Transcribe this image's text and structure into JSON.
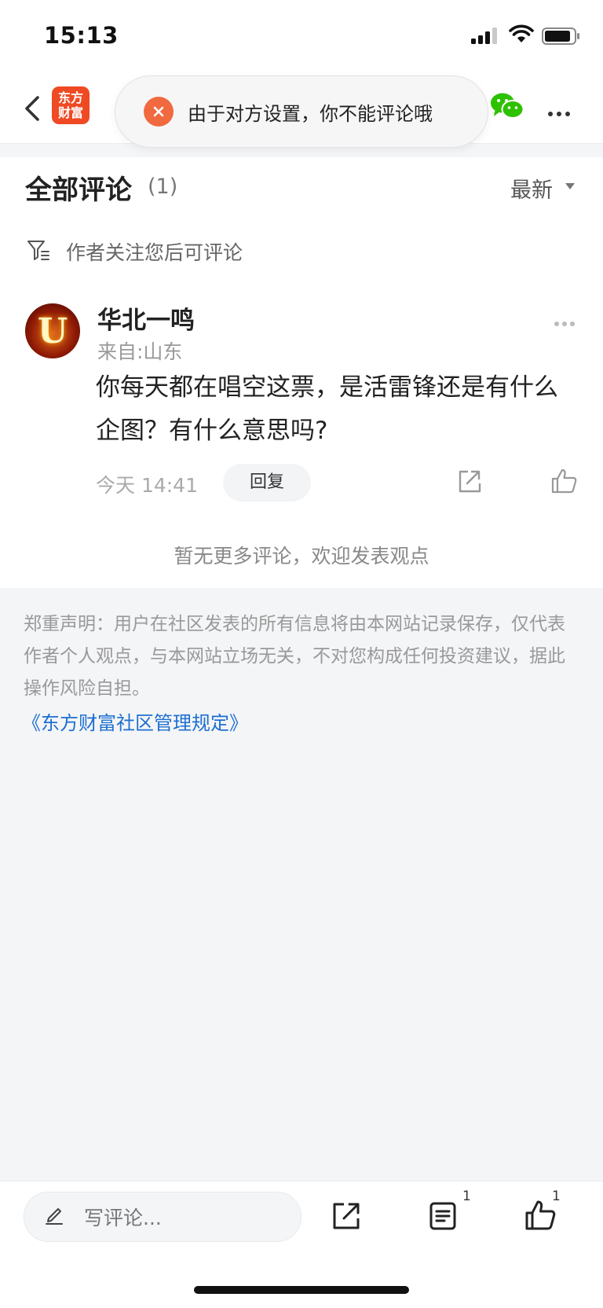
{
  "status_bar": {
    "time": "15:13"
  },
  "nav": {
    "logo_line1": "东方",
    "logo_line2": "财富",
    "toast_text": "由于对方设置，你不能评论哦"
  },
  "comments_section": {
    "title": "全部评论",
    "count": "(1)",
    "sort_label": "最新",
    "notice": "作者关注您后可评论",
    "items": [
      {
        "avatar_letter": "U",
        "username": "华北一鸣",
        "location": "来自:山东",
        "text": "你每天都在唱空这票，是活雷锋还是有什么企图？有什么意思吗?",
        "time": "今天 14:41",
        "reply_label": "回复"
      }
    ],
    "no_more": "暂无更多评论，欢迎发表观点"
  },
  "disclaimer": {
    "text": "郑重声明：用户在社区发表的所有信息将由本网站记录保存，仅代表作者个人观点，与本网站立场无关，不对您构成任何投资建议，据此操作风险自担。",
    "link": "《东方财富社区管理规定》"
  },
  "bottom_bar": {
    "input_placeholder": "写评论...",
    "list_badge": "1",
    "like_badge": "1"
  },
  "colors": {
    "brand": "#ef4a23",
    "toast_icon": "#f1693f",
    "link": "#1d6fd1",
    "wechat": "#2dc100"
  }
}
